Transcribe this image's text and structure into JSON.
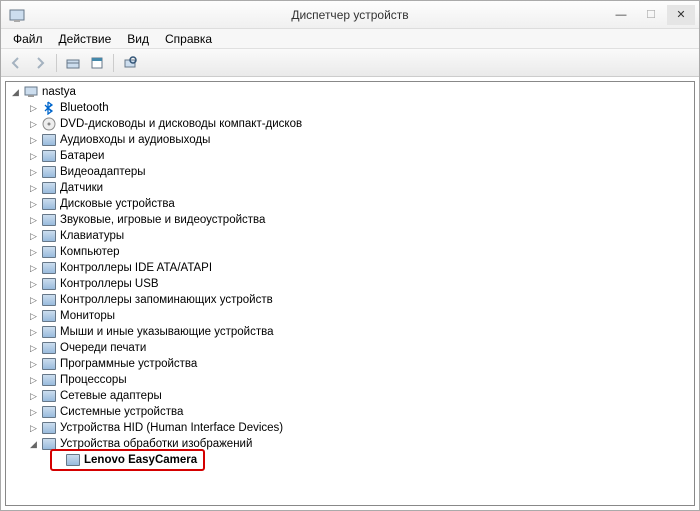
{
  "window": {
    "title": "Диспетчер устройств"
  },
  "menu": {
    "file": "Файл",
    "action": "Действие",
    "view": "Вид",
    "help": "Справка"
  },
  "tree": {
    "root": "nastya",
    "nodes": [
      {
        "label": "Bluetooth",
        "icon": "bluetooth"
      },
      {
        "label": "DVD-дисководы и дисководы компакт-дисков",
        "icon": "disc"
      },
      {
        "label": "Аудиовходы и аудиовыходы",
        "icon": "audio"
      },
      {
        "label": "Батареи",
        "icon": "battery"
      },
      {
        "label": "Видеоадаптеры",
        "icon": "display"
      },
      {
        "label": "Датчики",
        "icon": "sensor"
      },
      {
        "label": "Дисковые устройства",
        "icon": "disk"
      },
      {
        "label": "Звуковые, игровые и видеоустройства",
        "icon": "sound"
      },
      {
        "label": "Клавиатуры",
        "icon": "keyboard"
      },
      {
        "label": "Компьютер",
        "icon": "computer"
      },
      {
        "label": "Контроллеры IDE ATA/ATAPI",
        "icon": "ide"
      },
      {
        "label": "Контроллеры USB",
        "icon": "usb"
      },
      {
        "label": "Контроллеры запоминающих устройств",
        "icon": "storage"
      },
      {
        "label": "Мониторы",
        "icon": "monitor"
      },
      {
        "label": "Мыши и иные указывающие устройства",
        "icon": "mouse"
      },
      {
        "label": "Очереди печати",
        "icon": "printer"
      },
      {
        "label": "Программные устройства",
        "icon": "software"
      },
      {
        "label": "Процессоры",
        "icon": "cpu"
      },
      {
        "label": "Сетевые адаптеры",
        "icon": "network"
      },
      {
        "label": "Системные устройства",
        "icon": "system"
      },
      {
        "label": "Устройства HID (Human Interface Devices)",
        "icon": "hid"
      },
      {
        "label": "Устройства обработки изображений",
        "icon": "imaging",
        "expanded": true,
        "children": [
          {
            "label": "Lenovo EasyCamera",
            "icon": "camera",
            "highlighted": true,
            "bold": true
          }
        ]
      }
    ]
  }
}
